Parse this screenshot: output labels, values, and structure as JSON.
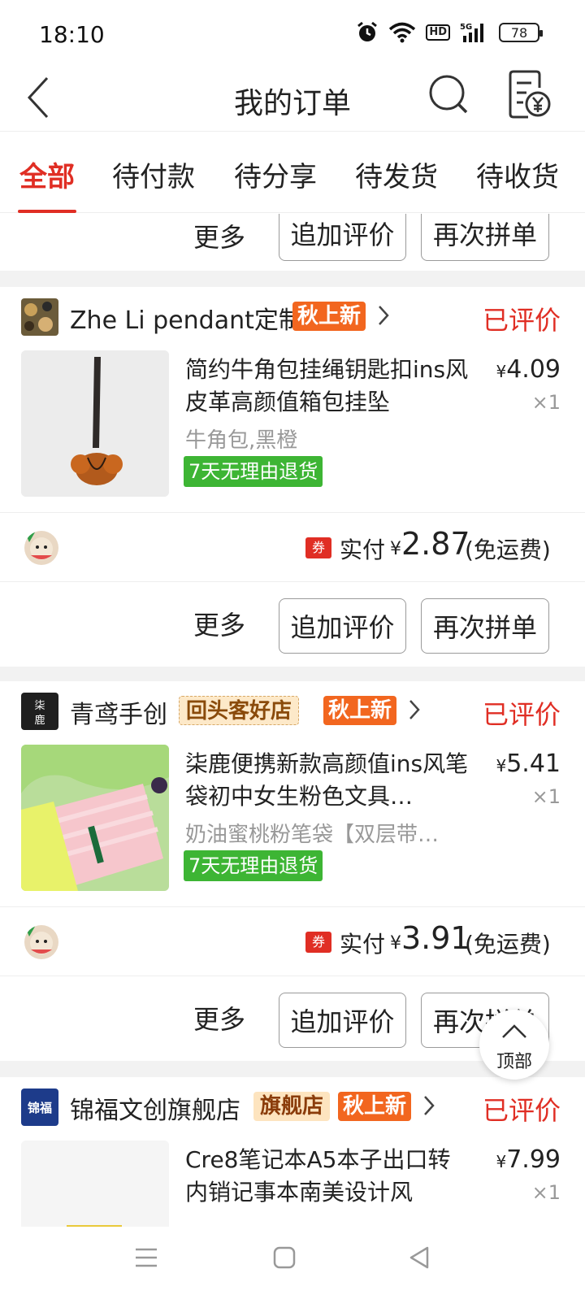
{
  "status_bar": {
    "time": "18:10",
    "hd": "HD",
    "network": "5G",
    "battery": "78"
  },
  "header": {
    "title": "我的订单"
  },
  "tabs": [
    {
      "label": "全部",
      "active": true
    },
    {
      "label": "待付款"
    },
    {
      "label": "待分享"
    },
    {
      "label": "待发货"
    },
    {
      "label": "待收货"
    }
  ],
  "order0": {
    "more": "更多",
    "review": "追加评价",
    "reorder": "再次拼单"
  },
  "order1": {
    "shop": "Zhe Li pendant定制",
    "badge_new": "秋上新",
    "status": "已评价",
    "title": "简约牛角包挂绳钥匙扣ins风皮革高颜值箱包挂坠",
    "price_symbol": "¥",
    "price": "4.09",
    "qty": "×1",
    "spec": "牛角包,黑橙",
    "return": "7天无理由退货",
    "coupon": "券",
    "paid_label": "实付",
    "paid_symbol": "¥",
    "paid": "2.87",
    "shipping": "(免运费)",
    "more": "更多",
    "review": "追加评价",
    "reorder": "再次拼单"
  },
  "order2": {
    "shop": "青鸢手创",
    "badge_loyal": "回头客好店",
    "badge_new": "秋上新",
    "status": "已评价",
    "title": "柒鹿便携新款高颜值ins风笔袋初中女生粉色文具…",
    "price_symbol": "¥",
    "price": "5.41",
    "qty": "×1",
    "spec": "奶油蜜桃粉笔袋【双层带…",
    "return": "7天无理由退货",
    "coupon": "券",
    "paid_label": "实付",
    "paid_symbol": "¥",
    "paid": "3.91",
    "shipping": "(免运费)",
    "more": "更多",
    "review": "追加评价",
    "reorder": "再次拼单",
    "logo_text": "柒鹿"
  },
  "order3": {
    "shop": "锦福文创旗舰店",
    "logo_text": "锦福",
    "badge_flag": "旗舰店",
    "badge_new": "秋上新",
    "status": "已评价",
    "title": "Cre8笔记本A5本子出口转内销记事本南美设计风",
    "price_symbol": "¥",
    "price": "7.99",
    "qty": "×1"
  },
  "float_top": {
    "label": "顶部"
  }
}
